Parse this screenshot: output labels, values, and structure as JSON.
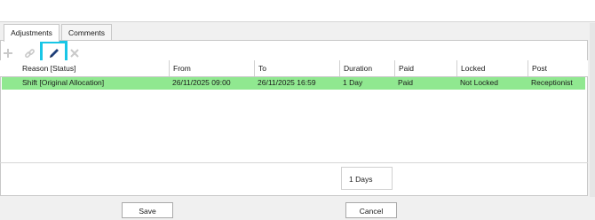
{
  "tabs": [
    {
      "label": "Adjustments",
      "active": true
    },
    {
      "label": "Comments",
      "active": false
    }
  ],
  "toolbar": {
    "add_icon": "plus-icon",
    "link_icon": "link-icon",
    "edit_icon": "pencil-icon",
    "delete_icon": "close-icon",
    "highlight_color": "#18c6e6"
  },
  "table": {
    "columns": [
      "Reason [Status]",
      "From",
      "To",
      "Duration",
      "Paid",
      "Locked",
      "Post"
    ],
    "rows": [
      [
        "Shift [Original Allocation]",
        "26/11/2025 09:00",
        "26/11/2025 16:59",
        "1 Day",
        "Paid",
        "Not Locked",
        "Receptionist"
      ]
    ],
    "row_color": "#90e890"
  },
  "total": {
    "duration": "1 Days"
  },
  "buttons": {
    "save": "Save",
    "cancel": "Cancel"
  }
}
